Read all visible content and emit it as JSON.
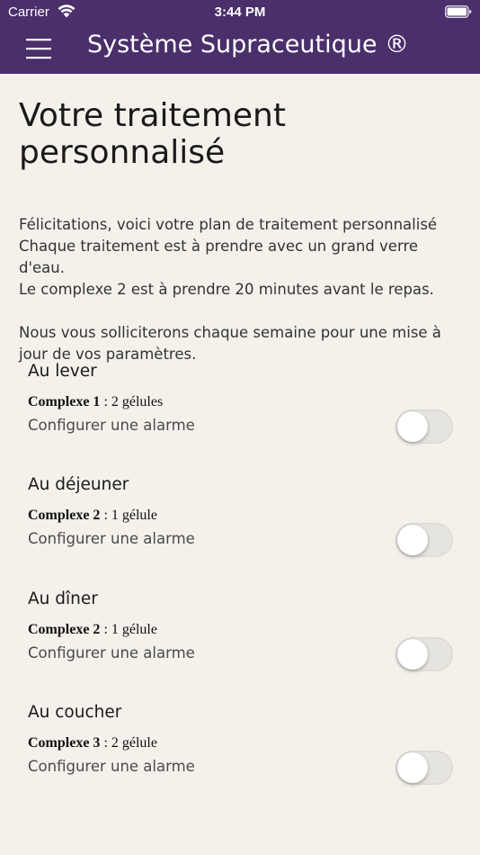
{
  "status_bar": {
    "carrier": "Carrier",
    "time": "3:44 PM"
  },
  "header": {
    "title": "Système Supraceutique ®",
    "background_color": "#4a2f6b"
  },
  "page": {
    "title": "Votre traitement personnalisé",
    "intro": [
      "Félicitations, voici votre plan de traitement personnalisé",
      "Chaque traitement est à prendre avec un grand verre d'eau.",
      "Le complexe 2 est à prendre 20 minutes avant le repas.",
      "Nous vous solliciterons chaque semaine pour une mise à jour de vos paramètres."
    ]
  },
  "schedule": [
    {
      "title": "Au lever",
      "complex": "Complexe 1",
      "dose": " : 2 gélules",
      "alarm_label": "Configurer une alarme",
      "alarm_on": false
    },
    {
      "title": "Au déjeuner",
      "complex": "Complexe 2",
      "dose": " : 1 gélule",
      "alarm_label": "Configurer une alarme",
      "alarm_on": false
    },
    {
      "title": "Au dîner",
      "complex": "Complexe 2",
      "dose": " : 1 gélule",
      "alarm_label": "Configurer une alarme",
      "alarm_on": false
    },
    {
      "title": "Au coucher",
      "complex": "Complexe 3",
      "dose": " : 2 gélule",
      "alarm_label": "Configurer une alarme",
      "alarm_on": false
    }
  ]
}
